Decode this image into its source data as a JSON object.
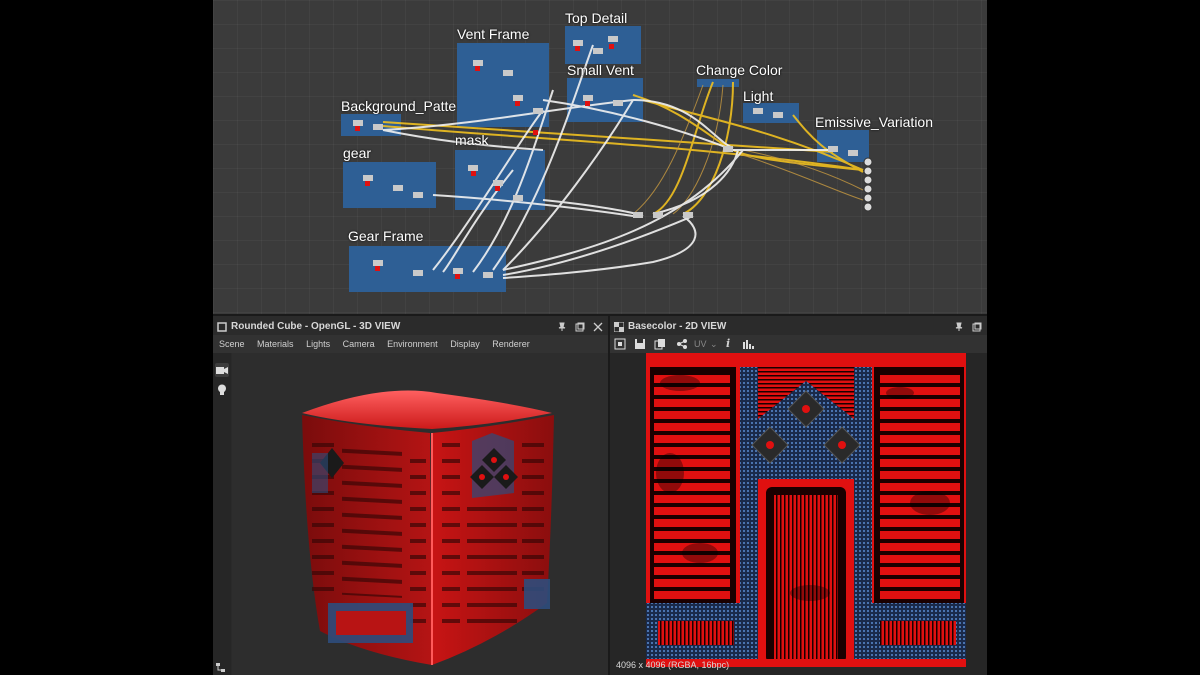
{
  "graph": {
    "frames": [
      {
        "id": "top-detail",
        "title": "Top Detail"
      },
      {
        "id": "vent-frame",
        "title": "Vent Frame"
      },
      {
        "id": "small-vent",
        "title": "Small Vent"
      },
      {
        "id": "change-color",
        "title": "Change Color"
      },
      {
        "id": "light",
        "title": "Light"
      },
      {
        "id": "background-pattern",
        "title": "Background_Patte"
      },
      {
        "id": "emissive-variation",
        "title": "Emissive_Variation"
      },
      {
        "id": "gear",
        "title": "gear"
      },
      {
        "id": "mask",
        "title": "mask"
      },
      {
        "id": "gear-frame",
        "title": "Gear Frame"
      }
    ]
  },
  "view3d": {
    "title": "Rounded Cube - OpenGL - 3D VIEW",
    "menu": [
      "Scene",
      "Materials",
      "Lights",
      "Camera",
      "Environment",
      "Display",
      "Renderer"
    ],
    "tools": [
      "camera-icon",
      "light-bulb-icon"
    ]
  },
  "view2d": {
    "title": "Basecolor - 2D VIEW",
    "toolbar": {
      "uv_label": "UV",
      "info_label": "i"
    },
    "status": "4096 x 4096 (RGBA, 16bpc)"
  },
  "colors": {
    "accent_red": "#e01010",
    "frame_blue": "#2e5f95",
    "link_yellow": "#f0c020"
  }
}
